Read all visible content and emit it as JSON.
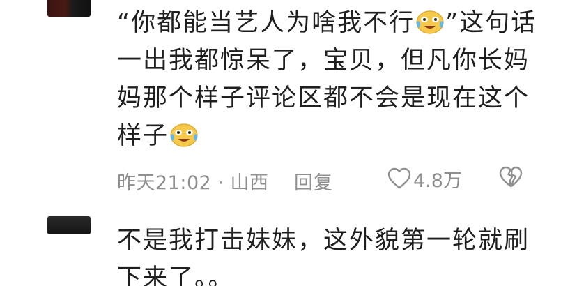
{
  "comments": [
    {
      "lines": [
        {
          "a": "“你都能当艺人为啥我不行",
          "b": "”这句话"
        },
        {
          "a": "一出我都惊呆了，宝贝，但凡你长妈"
        },
        {
          "a": "妈那个样子评论区都不会是现在这个"
        },
        {
          "a": "样子"
        }
      ],
      "meta": {
        "time_location": "昨天21:02 · 山西",
        "reply_label": "回复",
        "like_count": "4.8万"
      }
    },
    {
      "lines": [
        {
          "a": "不是我打击妹妹，这外貌第一轮就刷"
        },
        {
          "a": "下来了。。"
        }
      ]
    }
  ],
  "colors": {
    "text": "#1f1f1f",
    "meta": "#8f8f8f",
    "emoji_face": "#f6c94a"
  },
  "icons": {
    "emoji": "crying-laughing-emoji-icon",
    "like": "heart-outline-icon",
    "dislike": "broken-heart-icon"
  }
}
